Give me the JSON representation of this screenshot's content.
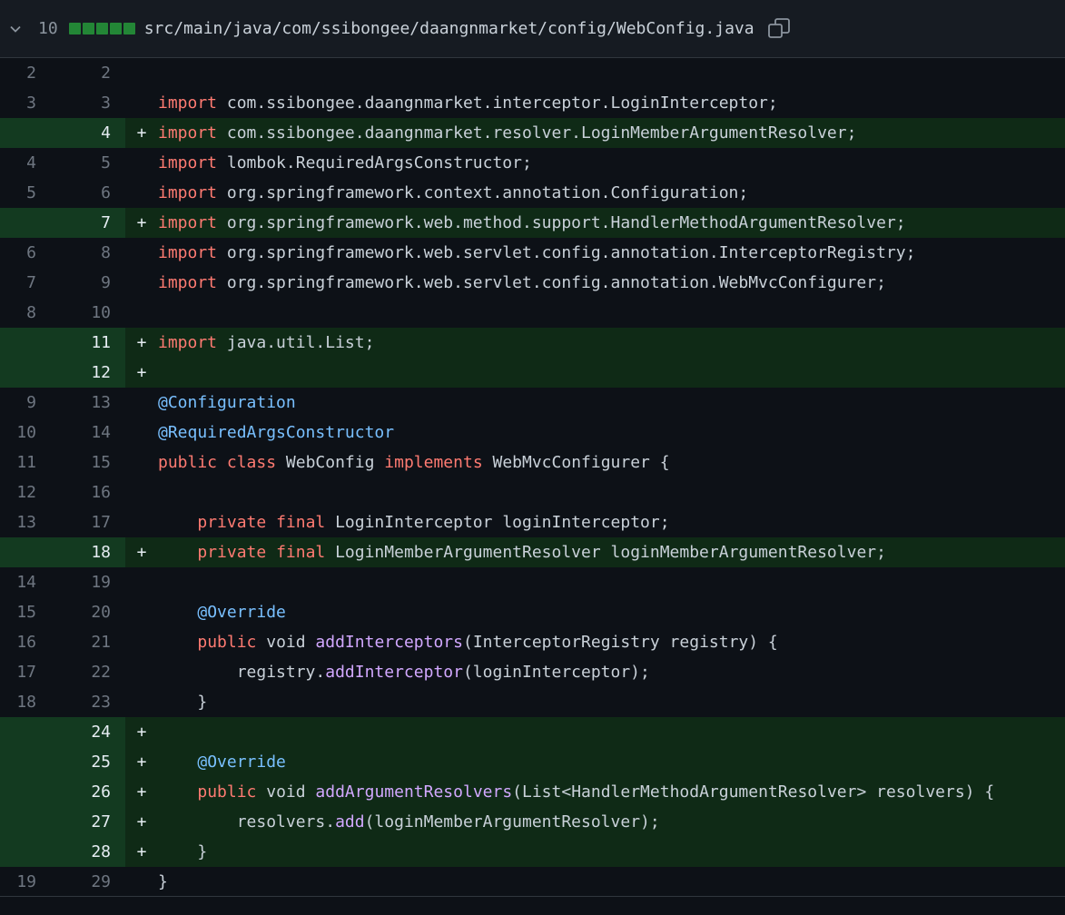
{
  "file": {
    "change_count": "10",
    "diffstat_blocks": 5,
    "path": "src/main/java/com/ssibongee/daangnmarket/config/WebConfig.java",
    "icons": {
      "toggle": "chevron-down-icon",
      "copy": "copy-icon"
    }
  },
  "colors": {
    "added_bg": "#0f2a16",
    "added_gutter": "#133a20",
    "keyword": "#ff7b72",
    "annotation": "#79c0ff",
    "method": "#d2a8ff",
    "text": "#c9d1d9"
  },
  "lines": [
    {
      "old": "2",
      "new": "2",
      "type": "context",
      "tokens": []
    },
    {
      "old": "3",
      "new": "3",
      "type": "context",
      "tokens": [
        {
          "t": "import",
          "c": "kw"
        },
        {
          "t": " com.ssibongee.daangnmarket.interceptor.LoginInterceptor;"
        }
      ]
    },
    {
      "old": "",
      "new": "4",
      "type": "add",
      "tokens": [
        {
          "t": "import",
          "c": "kw"
        },
        {
          "t": " com.ssibongee.daangnmarket.resolver.LoginMemberArgumentResolver;"
        }
      ]
    },
    {
      "old": "4",
      "new": "5",
      "type": "context",
      "tokens": [
        {
          "t": "import",
          "c": "kw"
        },
        {
          "t": " lombok.RequiredArgsConstructor;"
        }
      ]
    },
    {
      "old": "5",
      "new": "6",
      "type": "context",
      "tokens": [
        {
          "t": "import",
          "c": "kw"
        },
        {
          "t": " org.springframework.context.annotation.Configuration;"
        }
      ]
    },
    {
      "old": "",
      "new": "7",
      "type": "add",
      "tokens": [
        {
          "t": "import",
          "c": "kw"
        },
        {
          "t": " org.springframework.web.method.support.HandlerMethodArgumentResolver;"
        }
      ]
    },
    {
      "old": "6",
      "new": "8",
      "type": "context",
      "tokens": [
        {
          "t": "import",
          "c": "kw"
        },
        {
          "t": " org.springframework.web.servlet.config.annotation.InterceptorRegistry;"
        }
      ]
    },
    {
      "old": "7",
      "new": "9",
      "type": "context",
      "tokens": [
        {
          "t": "import",
          "c": "kw"
        },
        {
          "t": " org.springframework.web.servlet.config.annotation.WebMvcConfigurer;"
        }
      ]
    },
    {
      "old": "8",
      "new": "10",
      "type": "context",
      "tokens": []
    },
    {
      "old": "",
      "new": "11",
      "type": "add",
      "tokens": [
        {
          "t": "import",
          "c": "kw"
        },
        {
          "t": " java.util.List;"
        }
      ]
    },
    {
      "old": "",
      "new": "12",
      "type": "add",
      "tokens": []
    },
    {
      "old": "9",
      "new": "13",
      "type": "context",
      "tokens": [
        {
          "t": "@Configuration",
          "c": "an"
        }
      ]
    },
    {
      "old": "10",
      "new": "14",
      "type": "context",
      "tokens": [
        {
          "t": "@RequiredArgsConstructor",
          "c": "an"
        }
      ]
    },
    {
      "old": "11",
      "new": "15",
      "type": "context",
      "tokens": [
        {
          "t": "public",
          "c": "kw"
        },
        {
          "t": " "
        },
        {
          "t": "class",
          "c": "kw"
        },
        {
          "t": " WebConfig "
        },
        {
          "t": "implements",
          "c": "kw"
        },
        {
          "t": " WebMvcConfigurer {"
        }
      ]
    },
    {
      "old": "12",
      "new": "16",
      "type": "context",
      "tokens": []
    },
    {
      "old": "13",
      "new": "17",
      "type": "context",
      "tokens": [
        {
          "t": "    "
        },
        {
          "t": "private",
          "c": "kw"
        },
        {
          "t": " "
        },
        {
          "t": "final",
          "c": "kw"
        },
        {
          "t": " LoginInterceptor loginInterceptor;"
        }
      ]
    },
    {
      "old": "",
      "new": "18",
      "type": "add",
      "tokens": [
        {
          "t": "    "
        },
        {
          "t": "private",
          "c": "kw"
        },
        {
          "t": " "
        },
        {
          "t": "final",
          "c": "kw"
        },
        {
          "t": " LoginMemberArgumentResolver loginMemberArgumentResolver;"
        }
      ]
    },
    {
      "old": "14",
      "new": "19",
      "type": "context",
      "tokens": []
    },
    {
      "old": "15",
      "new": "20",
      "type": "context",
      "tokens": [
        {
          "t": "    "
        },
        {
          "t": "@Override",
          "c": "an"
        }
      ]
    },
    {
      "old": "16",
      "new": "21",
      "type": "context",
      "tokens": [
        {
          "t": "    "
        },
        {
          "t": "public",
          "c": "kw"
        },
        {
          "t": " void "
        },
        {
          "t": "addInterceptors",
          "c": "fn"
        },
        {
          "t": "(InterceptorRegistry registry) {"
        }
      ]
    },
    {
      "old": "17",
      "new": "22",
      "type": "context",
      "tokens": [
        {
          "t": "        registry."
        },
        {
          "t": "addInterceptor",
          "c": "fn"
        },
        {
          "t": "(loginInterceptor);"
        }
      ]
    },
    {
      "old": "18",
      "new": "23",
      "type": "context",
      "tokens": [
        {
          "t": "    }"
        }
      ]
    },
    {
      "old": "",
      "new": "24",
      "type": "add",
      "tokens": []
    },
    {
      "old": "",
      "new": "25",
      "type": "add",
      "tokens": [
        {
          "t": "    "
        },
        {
          "t": "@Override",
          "c": "an"
        }
      ]
    },
    {
      "old": "",
      "new": "26",
      "type": "add",
      "tokens": [
        {
          "t": "    "
        },
        {
          "t": "public",
          "c": "kw"
        },
        {
          "t": " void "
        },
        {
          "t": "addArgumentResolvers",
          "c": "fn"
        },
        {
          "t": "(List<HandlerMethodArgumentResolver> resolvers) {"
        }
      ]
    },
    {
      "old": "",
      "new": "27",
      "type": "add",
      "tokens": [
        {
          "t": "        resolvers."
        },
        {
          "t": "add",
          "c": "fn"
        },
        {
          "t": "(loginMemberArgumentResolver);"
        }
      ]
    },
    {
      "old": "",
      "new": "28",
      "type": "add",
      "tokens": [
        {
          "t": "    }"
        }
      ]
    },
    {
      "old": "19",
      "new": "29",
      "type": "context",
      "tokens": [
        {
          "t": "}"
        }
      ]
    }
  ]
}
